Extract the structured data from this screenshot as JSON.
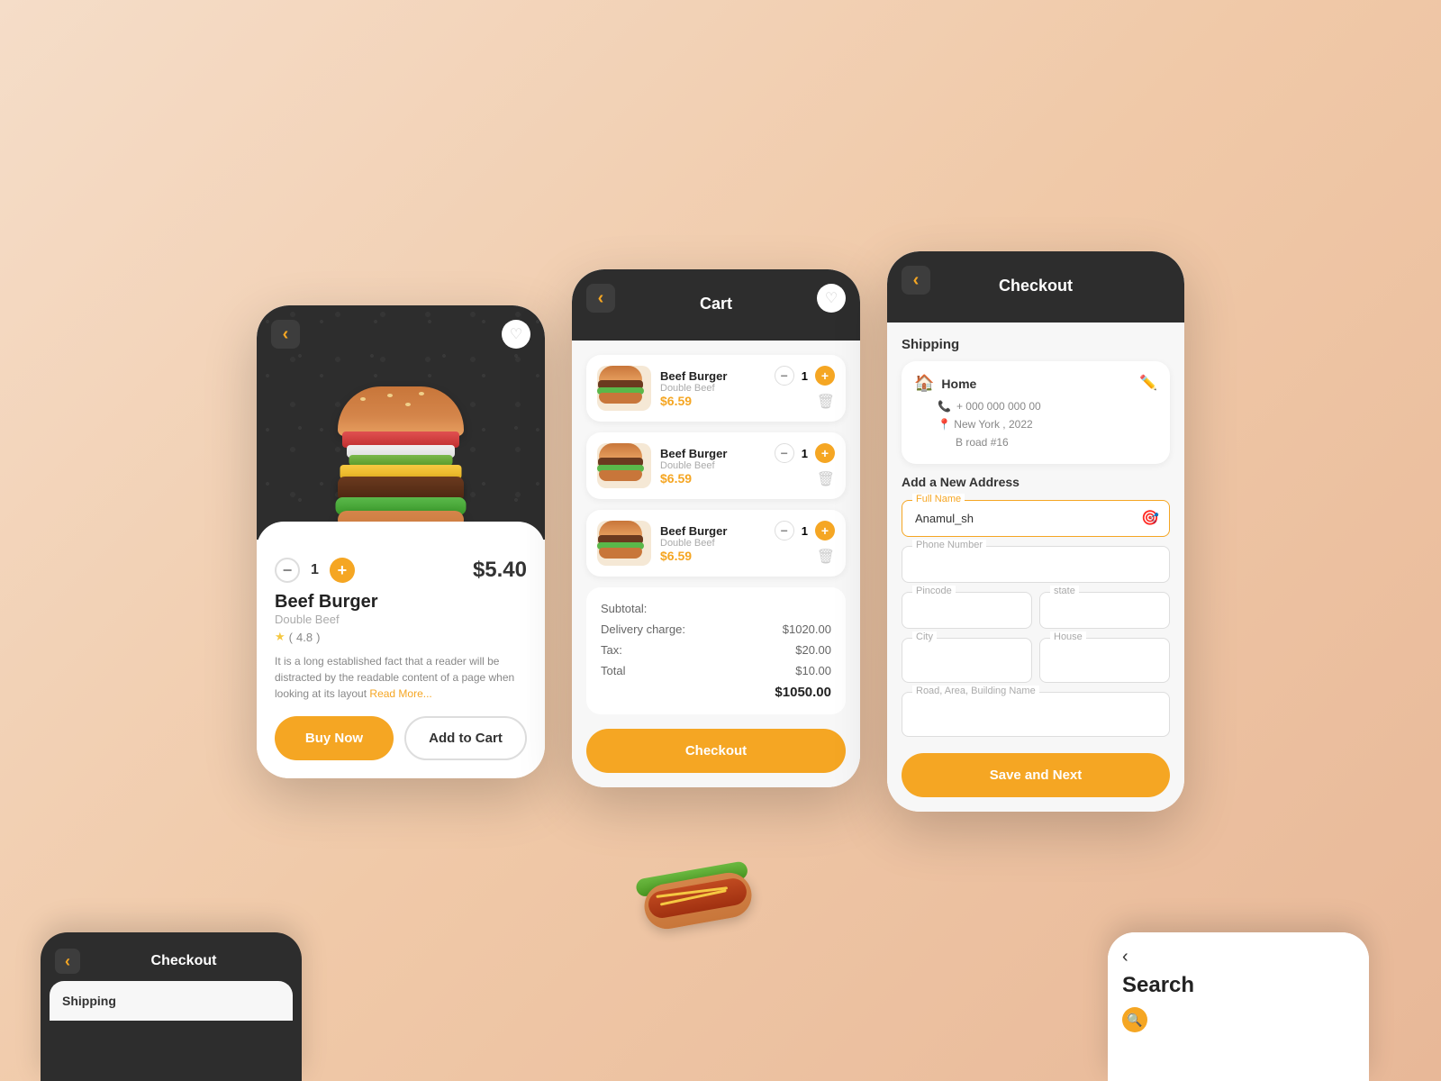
{
  "screens": {
    "product": {
      "title": "Beef Burger",
      "subtitle": "Double Beef",
      "price": "$5.40",
      "quantity": "1",
      "rating": "4.8",
      "description": "It is a long established fact that a reader will be distracted by the readable content of a page when looking at its layout",
      "read_more": "Read More...",
      "buy_now": "Buy Now",
      "add_to_cart": "Add to Cart"
    },
    "cart": {
      "title": "Cart",
      "items": [
        {
          "name": "Beef Burger",
          "sub": "Double Beef",
          "qty": "1",
          "price": "$6.59"
        },
        {
          "name": "Beef Burger",
          "sub": "Double Beef",
          "qty": "1",
          "price": "$6.59"
        },
        {
          "name": "Beef Burger",
          "sub": "Double Beef",
          "qty": "1",
          "price": "$6.59"
        }
      ],
      "subtotal_label": "Subtotal:",
      "delivery_label": "Delivery charge:",
      "tax_label": "Tax:",
      "total_label": "Total",
      "subtotal_value": "",
      "delivery_value": "$1020.00",
      "tax_value": "$20.00",
      "total_value": "$10.00",
      "grand_total": "$1050.00",
      "checkout_btn": "Checkout"
    },
    "checkout": {
      "title": "Checkout",
      "shipping_label": "Shipping",
      "home_label": "Home",
      "phone": "+ 000 000 000 00",
      "address_line1": "New York , 2022",
      "address_line2": "B road #16",
      "add_address_label": "Add a New Address",
      "full_name_label": "Full Name",
      "full_name_value": "Anamul_sh",
      "phone_label": "Phone Number",
      "pincode_label": "Pincode",
      "state_label": "state",
      "city_label": "City",
      "house_label": "House",
      "road_label": "Road, Area, Building Name",
      "save_btn": "Save and Next"
    },
    "checkout_partial": {
      "title": "Checkout",
      "shipping_label": "Shipping"
    },
    "search_partial": {
      "title": "Search",
      "back_arrow": "‹"
    }
  },
  "colors": {
    "orange": "#f5a623",
    "dark": "#2d2d2d",
    "white": "#ffffff",
    "light_gray": "#f7f7f7"
  }
}
